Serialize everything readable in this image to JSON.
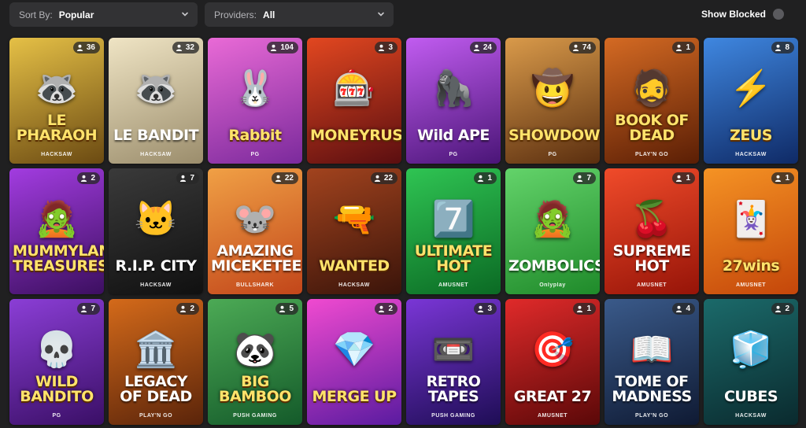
{
  "topbar": {
    "sort": {
      "label": "Sort By:",
      "value": "Popular"
    },
    "providers": {
      "label": "Providers:",
      "value": "All"
    },
    "show_blocked": {
      "label": "Show Blocked"
    }
  },
  "games": [
    {
      "title": "LE PHARAOH",
      "provider": "HACKSAW",
      "players": "36",
      "icon": "raccoon-pharaoh-icon",
      "glyph": "🦝",
      "bg": [
        "#e5c046",
        "#6b4a12"
      ],
      "title_color": "yellow"
    },
    {
      "title": "LE BANDIT",
      "provider": "HACKSAW",
      "players": "32",
      "icon": "raccoon-bandit-icon",
      "glyph": "🦝",
      "bg": [
        "#efe4c4",
        "#9b8d6c"
      ],
      "title_color": "white"
    },
    {
      "title": "Rabbit",
      "provider": "PG",
      "players": "104",
      "icon": "rabbit-icon",
      "glyph": "🐰",
      "bg": [
        "#e96ad6",
        "#7b2a9c"
      ],
      "title_color": "yellow"
    },
    {
      "title": "MONEYRUSH",
      "provider": "",
      "players": "3",
      "icon": "slot-machine-icon",
      "glyph": "🎰",
      "bg": [
        "#e24720",
        "#5a0e10"
      ],
      "title_color": "yellow"
    },
    {
      "title": "Wild APE",
      "provider": "PG",
      "players": "24",
      "icon": "ape-icon",
      "glyph": "🦍",
      "bg": [
        "#c15cf0",
        "#4a1577"
      ],
      "title_color": "white"
    },
    {
      "title": "SHOWDOWN",
      "provider": "PG",
      "players": "74",
      "icon": "cowgirl-icon",
      "glyph": "🤠",
      "bg": [
        "#d99a4a",
        "#5a2e0f"
      ],
      "title_color": "yellow"
    },
    {
      "title": "BOOK OF DEAD",
      "provider": "PLAY'N GO",
      "players": "1",
      "icon": "explorer-icon",
      "glyph": "🧔",
      "bg": [
        "#d46a23",
        "#5a1e05"
      ],
      "title_color": "yellow"
    },
    {
      "title": "ZEUS",
      "provider": "HACKSAW",
      "players": "8",
      "icon": "zeus-icon",
      "glyph": "⚡",
      "bg": [
        "#3f87e0",
        "#0f2a66"
      ],
      "title_color": "yellow"
    },
    {
      "title": "MUMMYLAND TREASURES",
      "provider": "",
      "players": "2",
      "icon": "mummy-icon",
      "glyph": "🧟",
      "bg": [
        "#a23ce0",
        "#3c0f60"
      ],
      "title_color": "yellow"
    },
    {
      "title": "R.I.P. CITY",
      "provider": "HACKSAW",
      "players": "7",
      "icon": "cat-icon",
      "glyph": "🐱",
      "bg": [
        "#3a3a3a",
        "#101010"
      ],
      "title_color": "white"
    },
    {
      "title": "AMAZING MICEKETEERS",
      "provider": "BULLSHARK",
      "players": "22",
      "icon": "mouse-icon",
      "glyph": "🐭",
      "bg": [
        "#f0a045",
        "#c2461a"
      ],
      "title_color": "white"
    },
    {
      "title": "WANTED",
      "provider": "HACKSAW",
      "players": "22",
      "icon": "outlaw-icon",
      "glyph": "🔫",
      "bg": [
        "#a2431e",
        "#3a140a"
      ],
      "title_color": "yellow"
    },
    {
      "title": "ULTIMATE HOT",
      "provider": "AMUSNET",
      "players": "1",
      "icon": "seven-icon",
      "glyph": "7️⃣",
      "bg": [
        "#2fc453",
        "#0b6a24"
      ],
      "title_color": "yellow"
    },
    {
      "title": "ZOMBOLICS",
      "provider": "Onlyplay",
      "players": "7",
      "icon": "zombie-cup-icon",
      "glyph": "🧟",
      "bg": [
        "#63d36a",
        "#1f8a2a"
      ],
      "title_color": "white"
    },
    {
      "title": "SUPREME HOT",
      "provider": "AMUSNET",
      "players": "1",
      "icon": "cherry-icon",
      "glyph": "🍒",
      "bg": [
        "#f04b2a",
        "#961408"
      ],
      "title_color": "white"
    },
    {
      "title": "27wins",
      "provider": "AMUSNET",
      "players": "1",
      "icon": "jester-icon",
      "glyph": "🃏",
      "bg": [
        "#f59324",
        "#c4460a"
      ],
      "title_color": "yellow"
    },
    {
      "title": "WILD BANDITO",
      "provider": "PG",
      "players": "7",
      "icon": "skull-sombrero-icon",
      "glyph": "💀",
      "bg": [
        "#8b3ed6",
        "#3a0f66"
      ],
      "title_color": "yellow"
    },
    {
      "title": "LEGACY OF DEAD",
      "provider": "PLAY'N GO",
      "players": "2",
      "icon": "temple-icon",
      "glyph": "🏛️",
      "bg": [
        "#d46a1a",
        "#5a240a"
      ],
      "title_color": "white"
    },
    {
      "title": "BIG BAMBOO",
      "provider": "PUSH GAMING",
      "players": "5",
      "icon": "panda-icon",
      "glyph": "🐼",
      "bg": [
        "#4caa55",
        "#145a2a"
      ],
      "title_color": "yellow"
    },
    {
      "title": "MERGE UP",
      "provider": "",
      "players": "2",
      "icon": "gem-icon",
      "glyph": "💎",
      "bg": [
        "#f04ad0",
        "#5a1ba0"
      ],
      "title_color": "yellow"
    },
    {
      "title": "RETRO TAPES",
      "provider": "PUSH GAMING",
      "players": "3",
      "icon": "cassette-icon",
      "glyph": "📼",
      "bg": [
        "#7a36d6",
        "#1e0d55"
      ],
      "title_color": "white"
    },
    {
      "title": "GREAT 27",
      "provider": "AMUSNET",
      "players": "1",
      "icon": "dartboard-icon",
      "glyph": "🎯",
      "bg": [
        "#e02a2a",
        "#5a0808"
      ],
      "title_color": "white"
    },
    {
      "title": "TOME OF MADNESS",
      "provider": "PLAY'N GO",
      "players": "4",
      "icon": "detective-icon",
      "glyph": "📖",
      "bg": [
        "#3a5a8a",
        "#0f1a33"
      ],
      "title_color": "white"
    },
    {
      "title": "CUBES",
      "provider": "HACKSAW",
      "players": "2",
      "icon": "cube-icon",
      "glyph": "🧊",
      "bg": [
        "#1b6a6a",
        "#0a2a2e"
      ],
      "title_color": "white"
    }
  ]
}
